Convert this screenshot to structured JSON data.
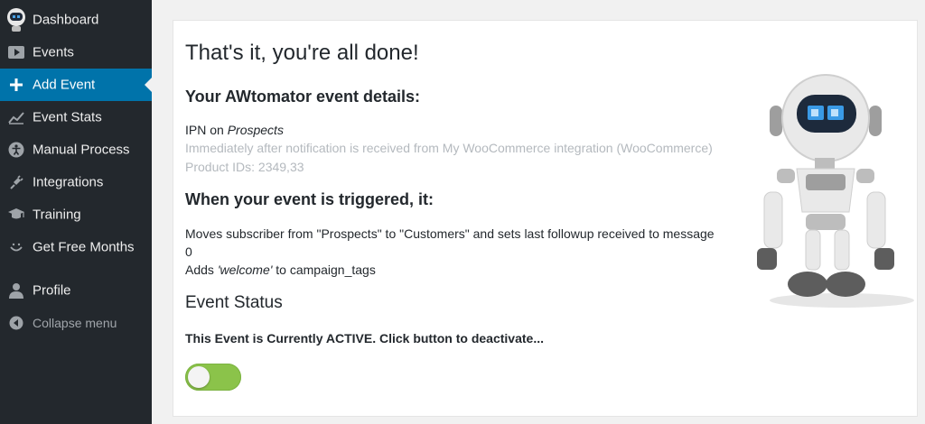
{
  "sidebar": {
    "items": [
      {
        "label": "Dashboard",
        "icon": "robot-avatar-icon"
      },
      {
        "label": "Events",
        "icon": "play-icon"
      },
      {
        "label": "Add Event",
        "icon": "plus-icon",
        "active": true
      },
      {
        "label": "Event Stats",
        "icon": "chart-line-icon"
      },
      {
        "label": "Manual Process",
        "icon": "accessibility-icon"
      },
      {
        "label": "Integrations",
        "icon": "plug-icon"
      },
      {
        "label": "Training",
        "icon": "graduation-cap-icon"
      },
      {
        "label": "Get Free Months",
        "icon": "smiley-icon"
      },
      {
        "label": "Profile",
        "icon": "user-icon"
      },
      {
        "label": "Collapse menu",
        "icon": "collapse-arrow-icon"
      }
    ]
  },
  "main": {
    "title": "That's it, you're all done!",
    "details_heading": "Your AWtomator event details:",
    "ipn_prefix": "IPN on ",
    "ipn_list": "Prospects",
    "notification_text": "Immediately after notification is received from My WooCommerce integration (WooCommerce)",
    "product_ids": "Product IDs: 2349,33",
    "trigger_heading": "When your event is triggered, it:",
    "action_move": "Moves subscriber from \"Prospects\" to \"Customers\" and sets last followup received to message",
    "action_move_cont": "0",
    "action_tag_prefix": "Adds ",
    "action_tag_name": "'welcome'",
    "action_tag_suffix": " to campaign_tags",
    "status_heading": "Event Status",
    "status_text": "This Event is Currently ACTIVE. Click button to deactivate...",
    "toggle_state": "active"
  },
  "colors": {
    "sidebar_bg": "#23282d",
    "active_bg": "#0073aa",
    "toggle_on": "#8bc34a",
    "muted_text": "#b4b9be"
  }
}
